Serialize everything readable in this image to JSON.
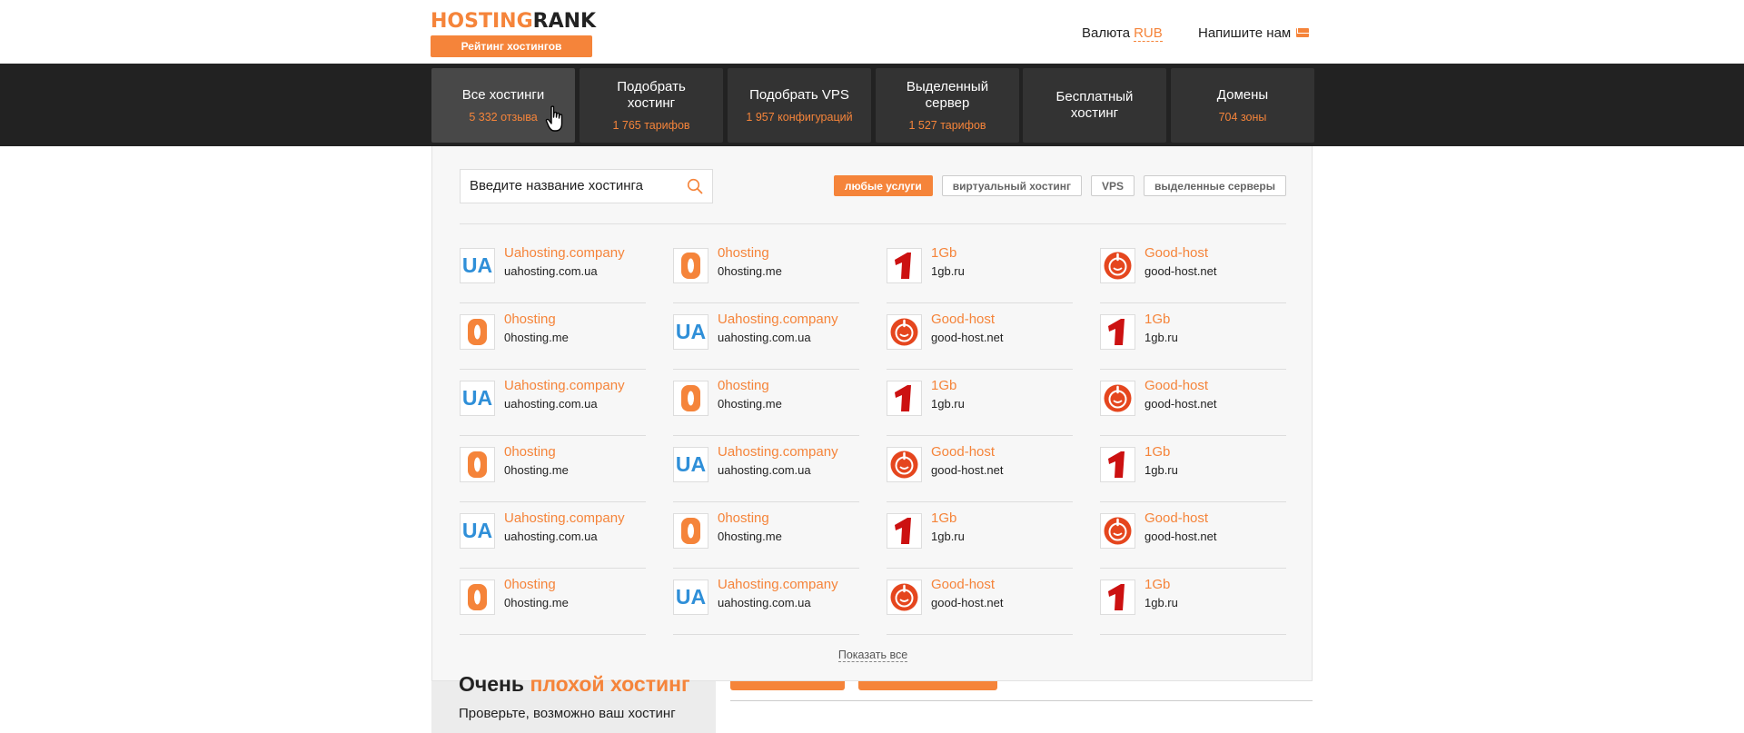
{
  "header": {
    "logo_part1": "HOSTING",
    "logo_part2": "RANK",
    "logo_sub": "Рейтинг хостингов",
    "currency_label": "Валюта",
    "currency_value": "RUB",
    "contact_label": "Напишите нам"
  },
  "nav": [
    {
      "title": "Все хостинги",
      "sub": "5 332 отзыва",
      "active": true
    },
    {
      "title": "Подобрать хостинг",
      "sub": "1 765 тарифов"
    },
    {
      "title": "Подобрать VPS",
      "sub": "1 957 конфигураций"
    },
    {
      "title": "Выделенный сервер",
      "sub": "1 527 тарифов"
    },
    {
      "title": "Бесплатный хостинг",
      "sub": ""
    },
    {
      "title": "Домены",
      "sub": "704 зоны"
    }
  ],
  "search": {
    "placeholder": "Введите название хостинга"
  },
  "filters": [
    "любые услуги",
    "виртуальный хостинг",
    "VPS",
    "выделенные серверы"
  ],
  "hosts": {
    "ua": {
      "name": "Uahosting.company",
      "domain": "uahosting.com.ua",
      "logo_text": "UA",
      "icon": "ua-logo-icon"
    },
    "zero": {
      "name": "0hosting",
      "domain": "0hosting.me",
      "logo_text": "0",
      "icon": "zero-logo-icon"
    },
    "gb": {
      "name": "1Gb",
      "domain": "1gb.ru",
      "logo_text": "1",
      "icon": "onegb-logo-icon"
    },
    "good": {
      "name": "Good-host",
      "domain": "good-host.net",
      "icon": "goodhost-logo-icon"
    }
  },
  "show_all": "Показать все",
  "below": {
    "title_part1": "Очень",
    "title_part2": "плохой хостинг",
    "text": "Проверьте, возможно ваш хостинг"
  },
  "colors": {
    "accent": "#f5843a",
    "nav_bg": "#222222",
    "ua_blue": "#2f8fd8",
    "gb_red": "#cc1111",
    "good_red": "#e5461e"
  }
}
